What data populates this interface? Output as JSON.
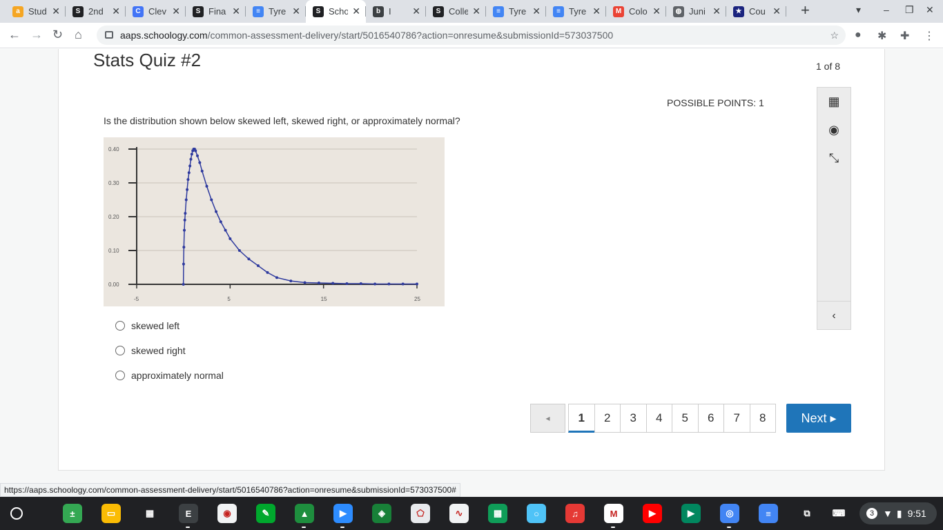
{
  "browser": {
    "tabs": [
      {
        "label": "Stud",
        "icon": "aa-icon",
        "color": "#f5a623",
        "glyph": "a"
      },
      {
        "label": "2nd",
        "icon": "schoology-icon",
        "color": "#202124",
        "glyph": "S"
      },
      {
        "label": "Clev",
        "icon": "clever-icon",
        "color": "#4274f6",
        "glyph": "C"
      },
      {
        "label": "Fina",
        "icon": "schoology-icon",
        "color": "#202124",
        "glyph": "S"
      },
      {
        "label": "Tyre",
        "icon": "docs-icon",
        "color": "#4285f4",
        "glyph": "≡"
      },
      {
        "label": "Scho",
        "icon": "schoology-icon",
        "color": "#202124",
        "glyph": "S"
      },
      {
        "label": "I",
        "icon": "blackboard-icon",
        "color": "#3c4043",
        "glyph": "b"
      },
      {
        "label": "Colle",
        "icon": "schoology-icon",
        "color": "#202124",
        "glyph": "S"
      },
      {
        "label": "Tyre",
        "icon": "docs-icon",
        "color": "#4285f4",
        "glyph": "≡"
      },
      {
        "label": "Tyre",
        "icon": "docs-icon",
        "color": "#4285f4",
        "glyph": "≡"
      },
      {
        "label": "Colo",
        "icon": "gmail-icon",
        "color": "#ea4335",
        "glyph": "M"
      },
      {
        "label": "Juni",
        "icon": "globe-icon",
        "color": "#5f6368",
        "glyph": "◍"
      },
      {
        "label": "Cou",
        "icon": "star-badge-icon",
        "color": "#1a237e",
        "glyph": "★"
      }
    ],
    "active_tab_index": 5,
    "url_host": "aaps.schoology.com",
    "url_path": "/common-assessment-delivery/start/5016540786?action=onresume&submissionId=573037500",
    "status_url": "https://aaps.schoology.com/common-assessment-delivery/start/5016540786?action=onresume&submissionId=573037500#"
  },
  "quiz": {
    "title": "Stats Quiz #2",
    "counter": "1 of 8",
    "points": "POSSIBLE POINTS: 1",
    "question": "Is the distribution shown below skewed left, skewed right, or approximately normal?",
    "options": [
      "skewed left",
      "skewed right",
      "approximately normal"
    ],
    "pages": [
      "1",
      "2",
      "3",
      "4",
      "5",
      "6",
      "7",
      "8"
    ],
    "current_page": "1",
    "prev_label": "◂",
    "next_label": "Next ▸"
  },
  "chart_data": {
    "type": "line",
    "y_ticks": [
      "0.40",
      "0.30",
      "0.20",
      "0.10",
      "0.00"
    ],
    "x_ticks": [
      "-5",
      "5",
      "15",
      "25"
    ],
    "xlim": [
      -5,
      25
    ],
    "ylim": [
      0,
      0.4
    ],
    "grid": true,
    "line_color": "#2e3a9e",
    "series": [
      {
        "x": [
          0,
          0.02,
          0.05,
          0.1,
          0.15,
          0.2,
          0.3,
          0.4,
          0.5,
          0.6,
          0.7,
          0.8,
          0.9,
          1.0,
          1.1,
          1.2,
          1.3,
          1.5,
          1.75,
          2.0,
          2.5,
          3.0,
          3.5,
          4.0,
          4.5,
          5.0,
          6.0,
          7.0,
          8.0,
          9.0,
          10.0,
          11.5,
          13.0,
          14.5,
          16.0,
          17.5,
          19.0,
          20.5,
          22.0,
          23.5,
          25.0
        ],
        "y": [
          0.0,
          0.06,
          0.11,
          0.16,
          0.19,
          0.21,
          0.25,
          0.28,
          0.31,
          0.33,
          0.35,
          0.37,
          0.385,
          0.395,
          0.4,
          0.4,
          0.395,
          0.38,
          0.36,
          0.335,
          0.29,
          0.25,
          0.215,
          0.185,
          0.16,
          0.135,
          0.1,
          0.075,
          0.055,
          0.035,
          0.02,
          0.01,
          0.005,
          0.004,
          0.003,
          0.002,
          0.002,
          0.001,
          0.001,
          0.001,
          0.001
        ]
      }
    ]
  },
  "shelf": {
    "apps": [
      {
        "name": "calculator-app-icon",
        "color": "#34a853",
        "glyph": "±"
      },
      {
        "name": "slides-app-icon",
        "color": "#fbbc04",
        "glyph": "▭"
      },
      {
        "name": "calculator-dark-app-icon",
        "color": "#202124",
        "glyph": "▦"
      },
      {
        "name": "e-app-icon",
        "color": "#3c4043",
        "glyph": "E"
      },
      {
        "name": "camera-app-icon",
        "color": "#f1f3f4",
        "glyph": "◉"
      },
      {
        "name": "evernote-app-icon",
        "color": "#00a82d",
        "glyph": "✎"
      },
      {
        "name": "drive-app-icon",
        "color": "#1e8e3e",
        "glyph": "▲"
      },
      {
        "name": "zoom-app-icon",
        "color": "#2d8cff",
        "glyph": "▶"
      },
      {
        "name": "bluebook-app-icon",
        "color": "#188038",
        "glyph": "◈"
      },
      {
        "name": "polygon-app-icon",
        "color": "#e8eaed",
        "glyph": "⬠"
      },
      {
        "name": "wave-app-icon",
        "color": "#f1f3f4",
        "glyph": "∿"
      },
      {
        "name": "sheets-app-icon",
        "color": "#0f9d58",
        "glyph": "▦"
      },
      {
        "name": "chat-app-icon",
        "color": "#4fc3f7",
        "glyph": "○"
      },
      {
        "name": "music-app-icon",
        "color": "#e53935",
        "glyph": "♫"
      },
      {
        "name": "gmail-app-icon",
        "color": "#ffffff",
        "glyph": "M"
      },
      {
        "name": "youtube-app-icon",
        "color": "#ff0000",
        "glyph": "▶"
      },
      {
        "name": "play-store-app-icon",
        "color": "#01875f",
        "glyph": "▶"
      },
      {
        "name": "chrome-app-icon",
        "color": "#4285f4",
        "glyph": "◎"
      },
      {
        "name": "docs-app-icon",
        "color": "#4285f4",
        "glyph": "≡"
      },
      {
        "name": "screen-capture-icon",
        "color": "#202124",
        "glyph": "⧉"
      },
      {
        "name": "keyboard-icon",
        "color": "#202124",
        "glyph": "⌨"
      }
    ],
    "notification_count": "3",
    "time": "9:51"
  }
}
